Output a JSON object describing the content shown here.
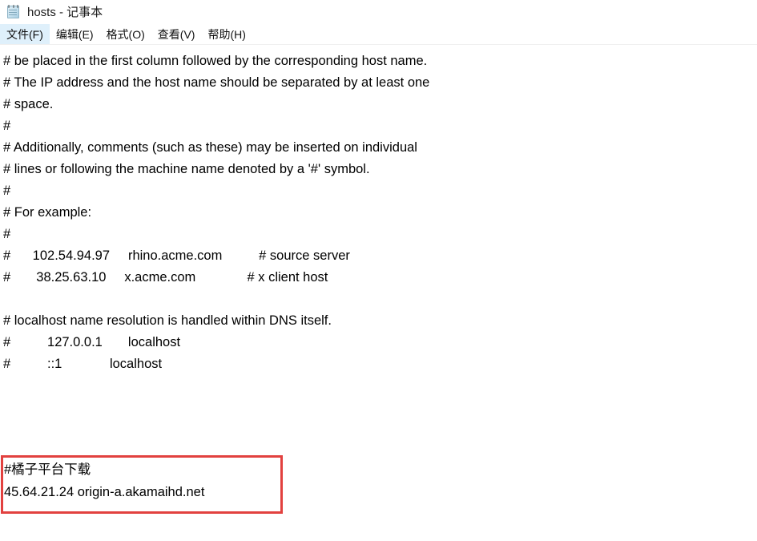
{
  "window": {
    "title": "hosts - 记事本",
    "icon": "notepad-icon"
  },
  "menubar": {
    "items": [
      {
        "label": "文件(F)",
        "selected": true
      },
      {
        "label": "编辑(E)",
        "selected": false
      },
      {
        "label": "格式(O)",
        "selected": false
      },
      {
        "label": "查看(V)",
        "selected": false
      },
      {
        "label": "帮助(H)",
        "selected": false
      }
    ]
  },
  "document": {
    "lines": [
      "# be placed in the first column followed by the corresponding host name.",
      "# The IP address and the host name should be separated by at least one",
      "# space.",
      "#",
      "# Additionally, comments (such as these) may be inserted on individual",
      "# lines or following the machine name denoted by a '#' symbol.",
      "#",
      "# For example:",
      "#",
      "#      102.54.94.97     rhino.acme.com          # source server",
      "#       38.25.63.10     x.acme.com              # x client host",
      "",
      "# localhost name resolution is handled within DNS itself.",
      "#          127.0.0.1       localhost",
      "#          ::1             localhost",
      "",
      "",
      ""
    ]
  },
  "annotation": {
    "border_color": "#e2413f",
    "lines": [
      "#橘子平台下载",
      "45.64.21.24 origin-a.akamaihd.net"
    ]
  }
}
